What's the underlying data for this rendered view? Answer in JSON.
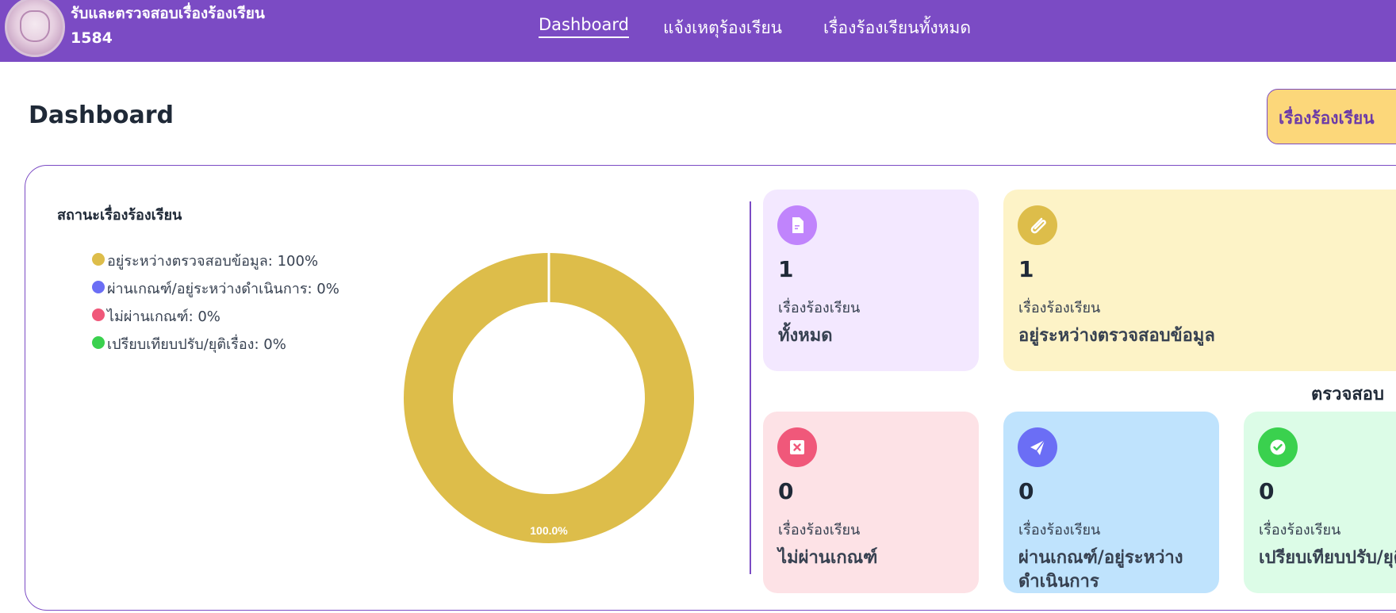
{
  "header": {
    "brand_line1": "รับและตรวจสอบเรื่องร้องเรียน",
    "brand_line2": "1584",
    "nav": [
      {
        "label": "Dashboard",
        "active": true
      },
      {
        "label": "แจ้งเหตุร้องเรียน",
        "active": false
      },
      {
        "label": "เรื่องร้องเรียนทั้งหมด",
        "active": false
      }
    ]
  },
  "page": {
    "title": "Dashboard",
    "cta_label": "เรื่องร้องเรียน"
  },
  "status_chart": {
    "title": "สถานะเรื่องร้องเรียน",
    "legend": [
      {
        "label": "อยู่ระหว่างตรวจสอบข้อมูล: 100%",
        "color": "#ddbd4a"
      },
      {
        "label": "ผ่านเกณฑ์/อยู่ระหว่างดำเนินการ: 0%",
        "color": "#6b6ef5"
      },
      {
        "label": "ไม่ผ่านเกณฑ์: 0%",
        "color": "#f0587a"
      },
      {
        "label": "เปรียบเทียบปรับ/ยุติเรื่อง: 0%",
        "color": "#3ad14e"
      }
    ],
    "slice_label": "100.0%"
  },
  "chart_data": {
    "type": "pie",
    "donut": true,
    "title": "สถานะเรื่องร้องเรียน",
    "categories": [
      "อยู่ระหว่างตรวจสอบข้อมูล",
      "ผ่านเกณฑ์/อยู่ระหว่างดำเนินการ",
      "ไม่ผ่านเกณฑ์",
      "เปรียบเทียบปรับ/ยุติเรื่อง"
    ],
    "values": [
      100,
      0,
      0,
      0
    ],
    "colors": [
      "#ddbd4a",
      "#6b6ef5",
      "#f0587a",
      "#3ad14e"
    ],
    "legend": "left"
  },
  "cards": {
    "subtitle": "เรื่องร้องเรียน",
    "section_label": "ตรวจสอบ",
    "total": {
      "count": "1",
      "label": "ทั้งหมด",
      "bg": "#f3e8ff",
      "icon_color": "#c084fc",
      "icon": "document-icon"
    },
    "checking": {
      "count": "1",
      "label": "อยู่ระหว่างตรวจสอบข้อมูล",
      "bg": "#fdf3c7",
      "icon_color": "#ddbd4a",
      "icon": "paperclip-icon"
    },
    "rejected": {
      "count": "0",
      "label": "ไม่ผ่านเกณฑ์",
      "bg": "#fde2e6",
      "icon_color": "#f0587a",
      "icon": "close-box-icon"
    },
    "in_progress": {
      "count": "0",
      "label": "ผ่านเกณฑ์/อยู่ระหว่างดำเนินการ",
      "bg": "#bfe3fd",
      "icon_color": "#6b6ef5",
      "icon": "send-icon"
    },
    "settled": {
      "count": "0",
      "label": "เปรียบเทียบปรับ/ยุติเรื่อง",
      "bg": "#dcfce7",
      "icon_color": "#3ad14e",
      "icon": "check-badge-icon"
    }
  }
}
